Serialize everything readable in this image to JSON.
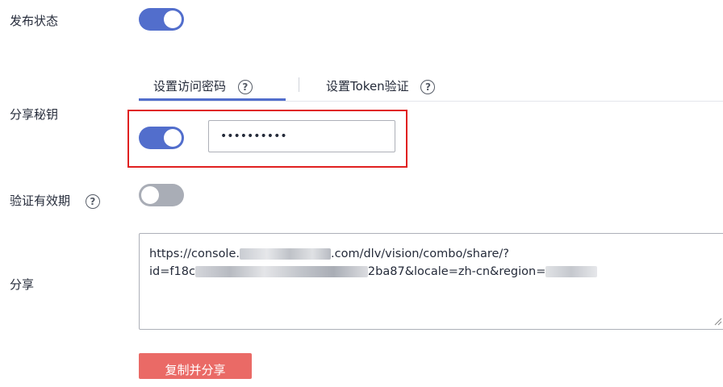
{
  "publish": {
    "label": "发布状态",
    "toggle_on": true
  },
  "tabs": [
    {
      "label": "设置访问密码",
      "active": true,
      "help": "?"
    },
    {
      "label": "设置Token验证",
      "active": false,
      "help": "?"
    }
  ],
  "share_key": {
    "label": "分享秘钥",
    "toggle_on": true,
    "password_value": "••••••••••"
  },
  "validity": {
    "label": "验证有效期",
    "help": "?",
    "toggle_on": false
  },
  "share": {
    "label": "分享",
    "url_line1_start": "https://console.",
    "url_line1_end": ".com/dlv/vision/combo/share/?",
    "url_line2_start": "id=f18c",
    "url_line2_mid": "2ba87&locale=zh-cn&region="
  },
  "copy_button": {
    "label": "复制并分享"
  },
  "colors": {
    "accent": "#526ecc",
    "highlight_border": "#e02020",
    "button_bg": "#ea6a66"
  }
}
